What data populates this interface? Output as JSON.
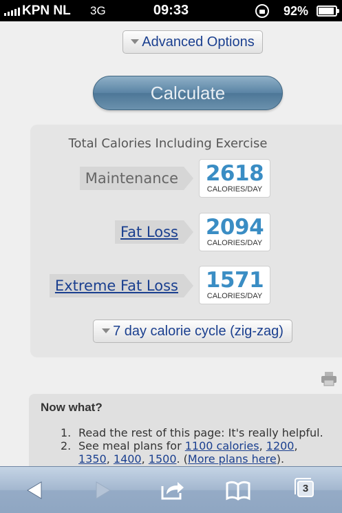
{
  "status_bar": {
    "carrier": "KPN NL",
    "network": "3G",
    "time": "09:33",
    "battery_percent": "92%"
  },
  "advanced_options": {
    "label": "Advanced Options"
  },
  "calculate": {
    "label": "Calculate"
  },
  "results": {
    "title": "Total Calories Including Exercise",
    "items": [
      {
        "label": "Maintenance",
        "value": "2618",
        "unit": "CALORIES/DAY",
        "link": false
      },
      {
        "label": "Fat Loss",
        "value": "2094",
        "unit": "CALORIES/DAY",
        "link": true
      },
      {
        "label": "Extreme Fat Loss",
        "value": "1571",
        "unit": "CALORIES/DAY",
        "link": true
      }
    ],
    "cycle_button": "7 day calorie cycle (zig-zag)"
  },
  "now_what": {
    "title": "Now what?",
    "item1_num": "1.",
    "item1_text": "Read the rest of this page: It's really helpful.",
    "item2_num": "2.",
    "item2_prefix": "See meal plans for ",
    "link_1100": "1100 calories",
    "link_1200": "1200",
    "link_1350": "1350",
    "link_1400": "1400",
    "link_1500": "1500",
    "link_more": "More plans here",
    "sep_comma": ", ",
    "open_paren": ". (",
    "close_paren": ")."
  },
  "toolbar": {
    "tabs_count": "3",
    "icons": [
      "back-icon",
      "forward-icon",
      "share-icon",
      "bookmarks-icon",
      "tabs-icon"
    ]
  },
  "colors": {
    "accent_number": "#3a8dc4",
    "link": "#1a3f8f",
    "calculate_button": "#5a84a5",
    "toolbar": "#a3b7cf"
  }
}
